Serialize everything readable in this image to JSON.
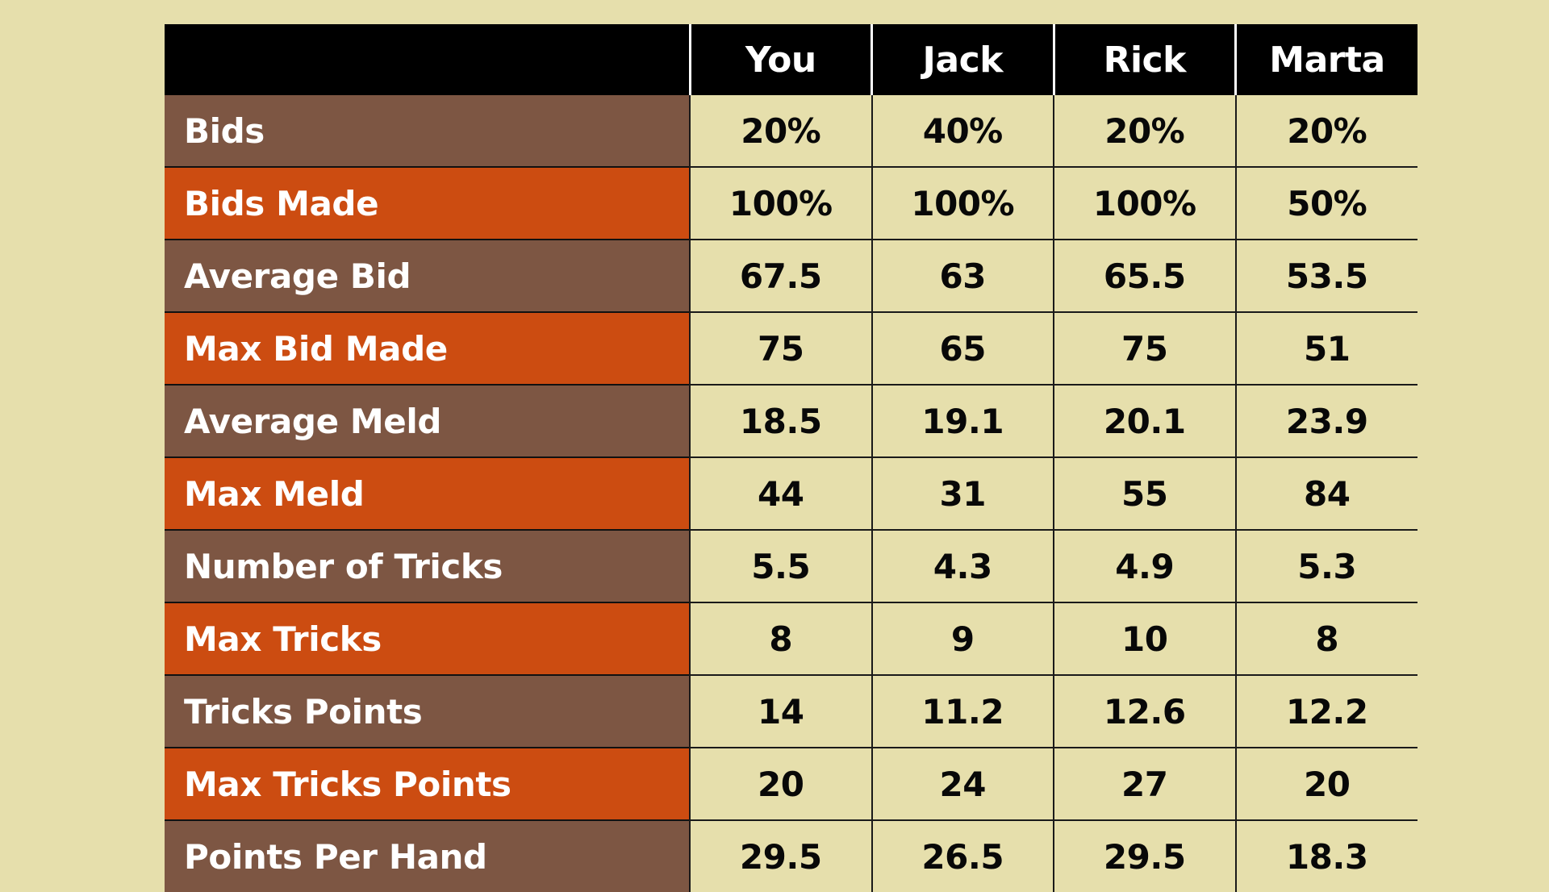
{
  "theme": {
    "page_background": "#E6DFAC",
    "header_background": "#000000",
    "header_text": "#FFFFFF",
    "label_band_a": "#7D5643",
    "label_band_b": "#CC4C11",
    "cell_background": "#E6DFAC",
    "cell_text": "#080808",
    "grid_line": "#1A1A1A"
  },
  "table": {
    "corner_label": "",
    "columns": [
      "You",
      "Jack",
      "Rick",
      "Marta"
    ],
    "rows": [
      {
        "label": "Bids",
        "band": "brown",
        "values": [
          "20%",
          "40%",
          "20%",
          "20%"
        ]
      },
      {
        "label": "Bids Made",
        "band": "orange",
        "values": [
          "100%",
          "100%",
          "100%",
          "50%"
        ]
      },
      {
        "label": "Average Bid",
        "band": "brown",
        "values": [
          "67.5",
          "63",
          "65.5",
          "53.5"
        ]
      },
      {
        "label": "Max Bid Made",
        "band": "orange",
        "values": [
          "75",
          "65",
          "75",
          "51"
        ]
      },
      {
        "label": "Average Meld",
        "band": "brown",
        "values": [
          "18.5",
          "19.1",
          "20.1",
          "23.9"
        ]
      },
      {
        "label": "Max Meld",
        "band": "orange",
        "values": [
          "44",
          "31",
          "55",
          "84"
        ]
      },
      {
        "label": "Number of Tricks",
        "band": "brown",
        "values": [
          "5.5",
          "4.3",
          "4.9",
          "5.3"
        ]
      },
      {
        "label": "Max Tricks",
        "band": "orange",
        "values": [
          "8",
          "9",
          "10",
          "8"
        ]
      },
      {
        "label": "Tricks Points",
        "band": "brown",
        "values": [
          "14",
          "11.2",
          "12.6",
          "12.2"
        ]
      },
      {
        "label": "Max Tricks Points",
        "band": "orange",
        "values": [
          "20",
          "24",
          "27",
          "20"
        ]
      },
      {
        "label": "Points Per Hand",
        "band": "brown",
        "values": [
          "29.5",
          "26.5",
          "29.5",
          "18.3"
        ]
      }
    ]
  },
  "chart_data": {
    "type": "table",
    "title": "",
    "categories": [
      "You",
      "Jack",
      "Rick",
      "Marta"
    ],
    "series": [
      {
        "name": "Bids",
        "values": [
          20,
          40,
          20,
          20
        ],
        "unit": "%"
      },
      {
        "name": "Bids Made",
        "values": [
          100,
          100,
          100,
          50
        ],
        "unit": "%"
      },
      {
        "name": "Average Bid",
        "values": [
          67.5,
          63,
          65.5,
          53.5
        ],
        "unit": ""
      },
      {
        "name": "Max Bid Made",
        "values": [
          75,
          65,
          75,
          51
        ],
        "unit": ""
      },
      {
        "name": "Average Meld",
        "values": [
          18.5,
          19.1,
          20.1,
          23.9
        ],
        "unit": ""
      },
      {
        "name": "Max Meld",
        "values": [
          44,
          31,
          55,
          84
        ],
        "unit": ""
      },
      {
        "name": "Number of Tricks",
        "values": [
          5.5,
          4.3,
          4.9,
          5.3
        ],
        "unit": ""
      },
      {
        "name": "Max Tricks",
        "values": [
          8,
          9,
          10,
          8
        ],
        "unit": ""
      },
      {
        "name": "Tricks Points",
        "values": [
          14,
          11.2,
          12.6,
          12.2
        ],
        "unit": ""
      },
      {
        "name": "Max Tricks Points",
        "values": [
          20,
          24,
          27,
          20
        ],
        "unit": ""
      },
      {
        "name": "Points Per Hand",
        "values": [
          29.5,
          26.5,
          29.5,
          18.3
        ],
        "unit": ""
      }
    ],
    "xlabel": "",
    "ylabel": "",
    "legend_position": "none",
    "grid": true
  }
}
